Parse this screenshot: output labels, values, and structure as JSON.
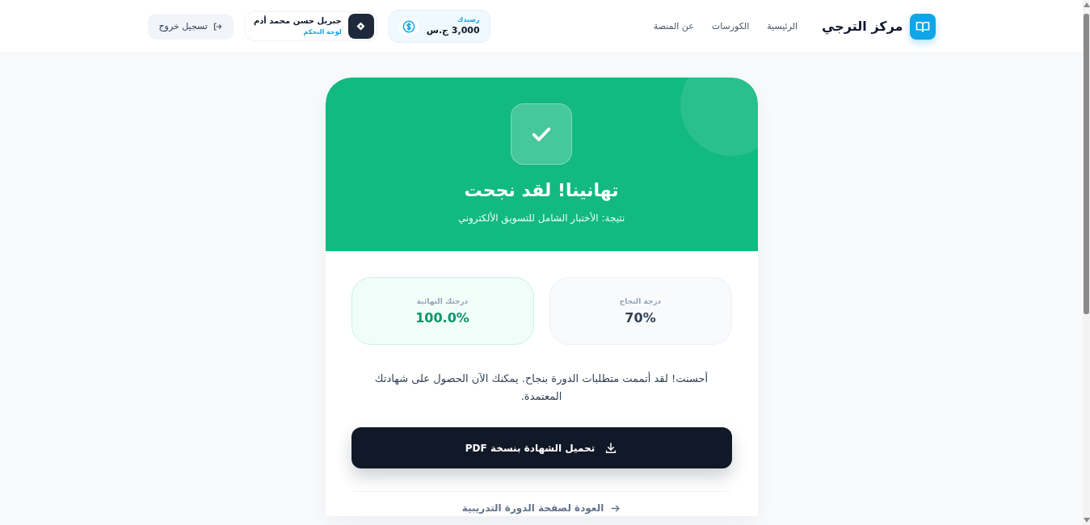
{
  "header": {
    "logo_text": "مركز الترجي",
    "nav": [
      {
        "label": "الرئيسية"
      },
      {
        "label": "الكورسات"
      },
      {
        "label": "عن المنصة"
      }
    ],
    "balance": {
      "label": "رصيدك",
      "amount": "3,000 ج.س"
    },
    "user": {
      "name": "جبريل حسن محمد أدم",
      "link": "لوحة التحكم"
    },
    "logout": "تسجيل خروج"
  },
  "result": {
    "title": "تهانينا! لقد نجحت",
    "subtitle": "نتيجة: الأختبار الشامل للتسويق الألكتروني",
    "stats": [
      {
        "kind": "pass",
        "label": "درجة النجاح",
        "value": "70%"
      },
      {
        "kind": "score",
        "label": "درجتك النهائية",
        "value": "100.0%"
      }
    ],
    "message": "أحسنت! لقد أتممت متطلبات الدورة بنجاح. يمكنك الآن الحصول على شهادتك المعتمدة.",
    "download_button": "تحميل الشهادة بنسخة PDF",
    "back_link": "العودة لصفحة الدورة التدريبية"
  }
}
